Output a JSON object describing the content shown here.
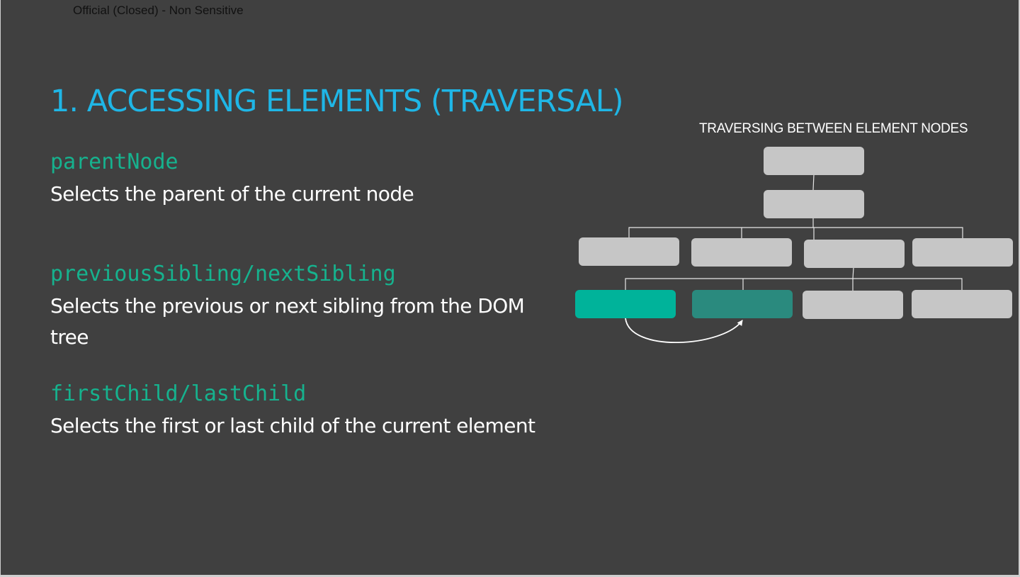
{
  "classification": "Official (Closed) - Non Sensitive",
  "slide": {
    "title": "1. ACCESSING ELEMENTS (TRAVERSAL)",
    "sections": [
      {
        "method": "parentNode",
        "description": "Selects the parent of the current node"
      },
      {
        "method": "previousSibling/nextSibling",
        "description": "Selects the previous or next sibling from the DOM tree"
      },
      {
        "method": "firstChild/lastChild",
        "description": "Selects the first or last child of the current element"
      }
    ]
  },
  "diagram": {
    "caption": "TRAVERSING BETWEEN ELEMENT NODES",
    "colors": {
      "node": "#c6c6c6",
      "highlight_primary": "#00b39a",
      "highlight_secondary": "#2a8a7e",
      "connector": "#e6e6e6",
      "background": "#404040",
      "title": "#1fb6e6",
      "method": "#16b28e"
    }
  }
}
